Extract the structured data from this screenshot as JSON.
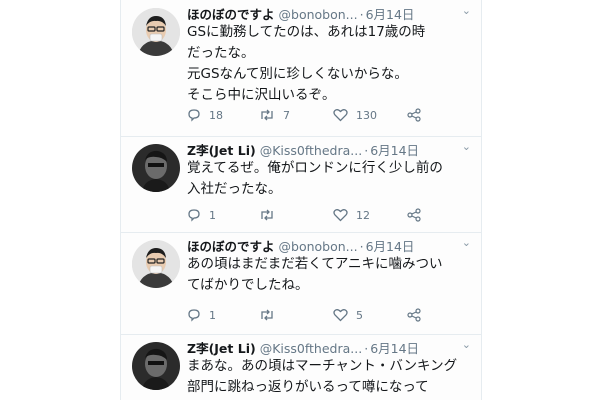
{
  "tweets": [
    {
      "name": "ほのぼのですよ",
      "handle": "@bonobon...",
      "date": "6月14日",
      "lines": [
        "GSに勤務してたのは、あれは17歳の時",
        "だったな。",
        "元GSなんて別に珍しくないからな。",
        "そこら中に沢山いるぞ。"
      ],
      "replies": "18",
      "retweets": "7",
      "likes": "130"
    },
    {
      "name": "Z李(Jet Li)",
      "handle": "@Kiss0fthedra...",
      "date": "6月14日",
      "lines": [
        "覚えてるぜ。俺がロンドンに行く少し前の",
        "入社だったな。"
      ],
      "replies": "1",
      "retweets": "",
      "likes": "12"
    },
    {
      "name": "ほのぼのですよ",
      "handle": "@bonobon...",
      "date": "6月14日",
      "lines": [
        "あの頃はまだまだ若くてアニキに噛みつい",
        "てばかりでしたね。"
      ],
      "replies": "1",
      "retweets": "",
      "likes": "5"
    },
    {
      "name": "Z李(Jet Li)",
      "handle": "@Kiss0fthedra...",
      "date": "6月14日",
      "lines": [
        "まあな。あの頃はマーチャント・バンキング",
        "部門に跳ねっ返りがいるって噂になって"
      ],
      "replies": "",
      "retweets": "",
      "likes": ""
    }
  ],
  "icons": {
    "avatar_a": "man-photo-avatar",
    "avatar_b": "dark-portrait-avatar",
    "reply": "reply-icon",
    "retweet": "retweet-icon",
    "like": "like-icon",
    "share": "share-icon",
    "caret": "chevron-down-icon"
  },
  "colors": {
    "text": "#14171a",
    "muted": "#657786",
    "border": "#e6ecf0"
  }
}
